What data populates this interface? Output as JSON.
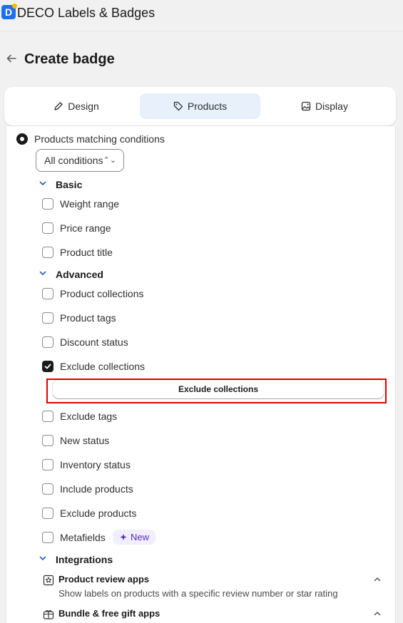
{
  "app": {
    "title": "DECO Labels & Badges",
    "logo_letter": "D"
  },
  "page": {
    "title": "Create badge",
    "back_icon": "arrow-left-icon"
  },
  "tabs": [
    {
      "label": "Design",
      "icon": "pencil-icon",
      "active": false
    },
    {
      "label": "Products",
      "icon": "tag-icon",
      "active": true
    },
    {
      "label": "Display",
      "icon": "image-icon",
      "active": false
    }
  ],
  "matching": {
    "radio_label": "Products matching conditions",
    "select_value": "All conditions"
  },
  "sections": {
    "basic": {
      "title": "Basic",
      "items": [
        "Weight range",
        "Price range",
        "Product title"
      ]
    },
    "advanced": {
      "title": "Advanced",
      "items": [
        {
          "label": "Product collections",
          "checked": false
        },
        {
          "label": "Product tags",
          "checked": false
        },
        {
          "label": "Discount status",
          "checked": false
        },
        {
          "label": "Exclude collections",
          "checked": true
        },
        {
          "label": "Exclude tags",
          "checked": false
        },
        {
          "label": "New status",
          "checked": false
        },
        {
          "label": "Inventory status",
          "checked": false
        },
        {
          "label": "Include products",
          "checked": false
        },
        {
          "label": "Exclude products",
          "checked": false
        },
        {
          "label": "Metafields",
          "checked": false
        }
      ],
      "exclude_collections_button": "Exclude collections",
      "new_badge": "New"
    },
    "integrations": {
      "title": "Integrations",
      "apps": [
        {
          "title": "Product review apps",
          "desc": "Show labels on products with a specific review number or star rating"
        },
        {
          "title": "Bundle & free gift apps",
          "desc": ""
        }
      ]
    }
  },
  "colors": {
    "accent_tab_bg": "#e7f0fb",
    "highlight_border": "#e00000",
    "new_badge_bg": "#f1eefe",
    "new_badge_text": "#5a2ab8"
  }
}
